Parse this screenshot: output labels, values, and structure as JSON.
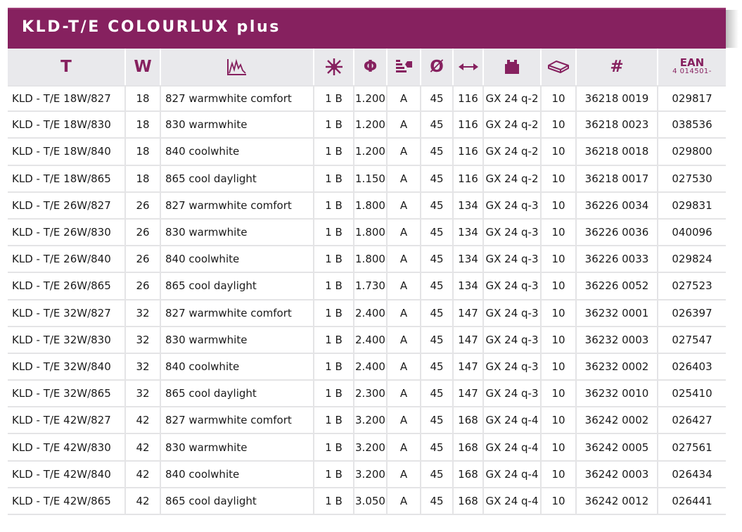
{
  "title": "KLD-T/E COLOURLUX plus",
  "accent_color": "#86215f",
  "header": {
    "type": "T",
    "watt": "W",
    "spectrum_icon": "spectrum-icon",
    "lightcolor_icon": "sun-icon",
    "flux": "Φ",
    "energy_icon": "energy-class-icon",
    "diameter": "Ø",
    "length_icon": "length-arrow-icon",
    "socket_icon": "socket-icon",
    "pack_icon": "package-icon",
    "article": "#",
    "ean_title": "EAN",
    "ean_prefix": "4 014501-"
  },
  "rows": [
    [
      "KLD - T/E 18W/827",
      "18",
      "827 warmwhite comfort",
      "1 B",
      "1.200",
      "A",
      "45",
      "116",
      "GX 24 q-2",
      "10",
      "36218 0019",
      "029817"
    ],
    [
      "KLD - T/E 18W/830",
      "18",
      "830 warmwhite",
      "1 B",
      "1.200",
      "A",
      "45",
      "116",
      "GX 24 q-2",
      "10",
      "36218 0023",
      "038536"
    ],
    [
      "KLD - T/E 18W/840",
      "18",
      "840 coolwhite",
      "1 B",
      "1.200",
      "A",
      "45",
      "116",
      "GX 24 q-2",
      "10",
      "36218 0018",
      "029800"
    ],
    [
      "KLD - T/E 18W/865",
      "18",
      "865 cool daylight",
      "1 B",
      "1.150",
      "A",
      "45",
      "116",
      "GX 24 q-2",
      "10",
      "36218 0017",
      "027530"
    ],
    [
      "KLD - T/E 26W/827",
      "26",
      "827 warmwhite comfort",
      "1 B",
      "1.800",
      "A",
      "45",
      "134",
      "GX 24 q-3",
      "10",
      "36226 0034",
      "029831"
    ],
    [
      "KLD - T/E 26W/830",
      "26",
      "830 warmwhite",
      "1 B",
      "1.800",
      "A",
      "45",
      "134",
      "GX 24 q-3",
      "10",
      "36226 0036",
      "040096"
    ],
    [
      "KLD - T/E 26W/840",
      "26",
      "840 coolwhite",
      "1 B",
      "1.800",
      "A",
      "45",
      "134",
      "GX 24 q-3",
      "10",
      "36226 0033",
      "029824"
    ],
    [
      "KLD - T/E 26W/865",
      "26",
      "865 cool daylight",
      "1 B",
      "1.730",
      "A",
      "45",
      "134",
      "GX 24 q-3",
      "10",
      "36226 0052",
      "027523"
    ],
    [
      "KLD - T/E 32W/827",
      "32",
      "827 warmwhite comfort",
      "1 B",
      "2.400",
      "A",
      "45",
      "147",
      "GX 24 q-3",
      "10",
      "36232 0001",
      "026397"
    ],
    [
      "KLD - T/E 32W/830",
      "32",
      "830 warmwhite",
      "1 B",
      "2.400",
      "A",
      "45",
      "147",
      "GX 24 q-3",
      "10",
      "36232 0003",
      "027547"
    ],
    [
      "KLD - T/E 32W/840",
      "32",
      "840 coolwhite",
      "1 B",
      "2.400",
      "A",
      "45",
      "147",
      "GX 24 q-3",
      "10",
      "36232 0002",
      "026403"
    ],
    [
      "KLD - T/E 32W/865",
      "32",
      "865 cool daylight",
      "1 B",
      "2.300",
      "A",
      "45",
      "147",
      "GX 24 q-3",
      "10",
      "36232 0010",
      "025410"
    ],
    [
      "KLD - T/E 42W/827",
      "42",
      "827 warmwhite comfort",
      "1 B",
      "3.200",
      "A",
      "45",
      "168",
      "GX 24 q-4",
      "10",
      "36242 0002",
      "026427"
    ],
    [
      "KLD - T/E 42W/830",
      "42",
      "830 warmwhite",
      "1 B",
      "3.200",
      "A",
      "45",
      "168",
      "GX 24 q-4",
      "10",
      "36242 0005",
      "027561"
    ],
    [
      "KLD - T/E 42W/840",
      "42",
      "840 coolwhite",
      "1 B",
      "3.200",
      "A",
      "45",
      "168",
      "GX 24 q-4",
      "10",
      "36242 0003",
      "026434"
    ],
    [
      "KLD - T/E 42W/865",
      "42",
      "865 cool daylight",
      "1 B",
      "3.050",
      "A",
      "45",
      "168",
      "GX 24 q-4",
      "10",
      "36242 0012",
      "026441"
    ]
  ]
}
